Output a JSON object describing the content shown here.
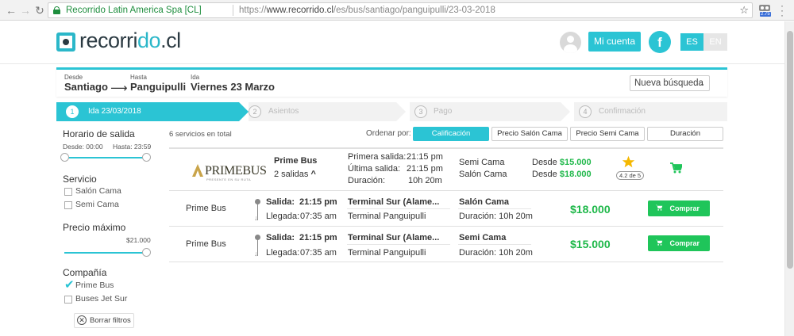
{
  "browser": {
    "site_identity": "Recorrido Latin America Spa [CL]",
    "url_prefix": "https://",
    "url_host": "www.recorrido.cl",
    "url_path": "/es/bus/santiago/panguipulli/23-03-2018",
    "extension_badge": "2.75"
  },
  "header": {
    "logo_part1": "recorr",
    "logo_part2": "i",
    "logo_part3": "do",
    "logo_part4": ".cl",
    "account_label": "Mi cuenta",
    "facebook_label": "f",
    "lang_es": "ES",
    "lang_en": "EN"
  },
  "search": {
    "from_label": "Desde",
    "from_value": "Santiago",
    "arrow": "⟶",
    "to_label": "Hasta",
    "to_value": "Panguipulli",
    "date_label": "Ida",
    "date_value": "Viernes 23 Marzo",
    "new_search": "Nueva búsqueda"
  },
  "steps": [
    {
      "num": "1",
      "label": "Ida 23/03/2018"
    },
    {
      "num": "2",
      "label": "Asientos"
    },
    {
      "num": "3",
      "label": "Pago"
    },
    {
      "num": "4",
      "label": "Confirmación"
    }
  ],
  "filters": {
    "departure_title": "Horario de salida",
    "departure_from": "Desde: 00:00",
    "departure_to": "Hasta: 23:59",
    "service_title": "Servicio",
    "service_options": [
      "Salón Cama",
      "Semi Cama"
    ],
    "price_title": "Precio máximo",
    "price_max": "$21.000",
    "company_title": "Compañía",
    "company_options": [
      {
        "label": "Prime Bus",
        "checked": true
      },
      {
        "label": "Buses Jet Sur",
        "checked": false
      }
    ],
    "clear_label": "Borrar filtros"
  },
  "results": {
    "count": "6 servicios en total",
    "sort_label": "Ordenar por:",
    "sort_options": [
      "Calificación",
      "Precio Salón Cama",
      "Precio Semi Cama",
      "Duración"
    ],
    "company": {
      "logo_word": "PRIMEBUS",
      "logo_sub": "PRESENTE EN SU RUTA",
      "name": "Prime Bus",
      "departures": "2 salidas",
      "first_label": "Primera salida:",
      "first_time": "21:15 pm",
      "last_label": "Última salida:",
      "last_time": "21:15 pm",
      "duration_label": "Duración:",
      "duration": "10h 20m",
      "class1": "Semi Cama",
      "class2": "Salón Cama",
      "from_label": "Desde",
      "price1": "$15.000",
      "price2": "$18.000",
      "rating": "4.2 de 5",
      "rating_value": 4.2
    },
    "trips": [
      {
        "company": "Prime Bus",
        "dep_label": "Salida:",
        "dep_time": "21:15 pm",
        "arr_label": "Llegada:",
        "arr_time": "07:35 am",
        "origin": "Terminal Sur (Alame...",
        "destination": "Terminal Panguipulli",
        "class": "Salón Cama",
        "duration": "Duración: 10h 20m",
        "price": "$18.000",
        "buy": "Comprar"
      },
      {
        "company": "Prime Bus",
        "dep_label": "Salida:",
        "dep_time": "21:15 pm",
        "arr_label": "Llegada:",
        "arr_time": "07:35 am",
        "origin": "Terminal Sur (Alame...",
        "destination": "Terminal Panguipulli",
        "class": "Semi Cama",
        "duration": "Duración: 10h 20m",
        "price": "$15.000",
        "buy": "Comprar"
      }
    ]
  },
  "colors": {
    "brand": "#2bc4d4",
    "price_green": "#1fb84a",
    "buy_green": "#1fc55a",
    "star": "#f5b800"
  }
}
